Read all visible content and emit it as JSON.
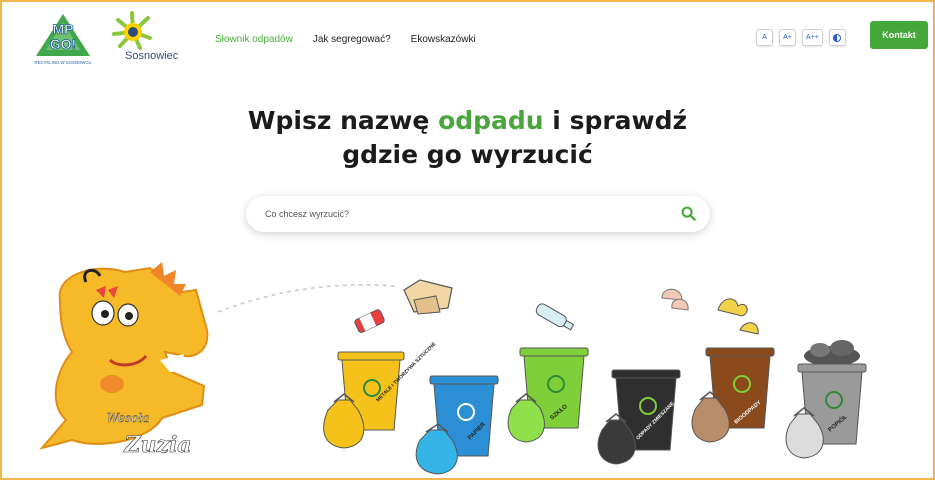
{
  "header": {
    "logo_mpgo": {
      "line1": "MP",
      "line2": "GO!",
      "tagline": "RECYKLING W SOSNOWCU"
    },
    "logo_city": "Sosnowiec",
    "nav": [
      {
        "label": "Słownik odpadów",
        "active": true
      },
      {
        "label": "Jak segregować?",
        "active": false
      },
      {
        "label": "Ekowskazówki",
        "active": false
      }
    ],
    "font_size_buttons": [
      "A",
      "A+",
      "A++"
    ],
    "contrast_icon": "contrast-icon",
    "contact_label": "Kontakt"
  },
  "hero": {
    "title_part1": "Wpisz nazwę ",
    "title_highlight": "odpadu",
    "title_part2": " i sprawdź",
    "title_line2": "gdzie go wyrzucić"
  },
  "search": {
    "placeholder": "Co chcesz wyrzucić?",
    "value": "",
    "icon": "search-icon"
  },
  "mascot": {
    "line1": "Wesoła",
    "line2": "Zuzia"
  },
  "bins": [
    {
      "label": "METALE I TWORZYWA SZTUCZNE",
      "color": "#f5c21b"
    },
    {
      "label": "PAPIER",
      "color": "#2c8fd6"
    },
    {
      "label": "SZKŁO",
      "color": "#7fcf3a"
    },
    {
      "label": "ODPADY ZMIESZANE",
      "color": "#2f2f2f"
    },
    {
      "label": "BIOODPADY",
      "color": "#8a4a1c"
    },
    {
      "label": "POPIÓŁ",
      "color": "#9a9a9a"
    }
  ],
  "colors": {
    "accent": "#43a838",
    "title_highlight": "#4aa63c",
    "frame": "#f0b74a"
  }
}
